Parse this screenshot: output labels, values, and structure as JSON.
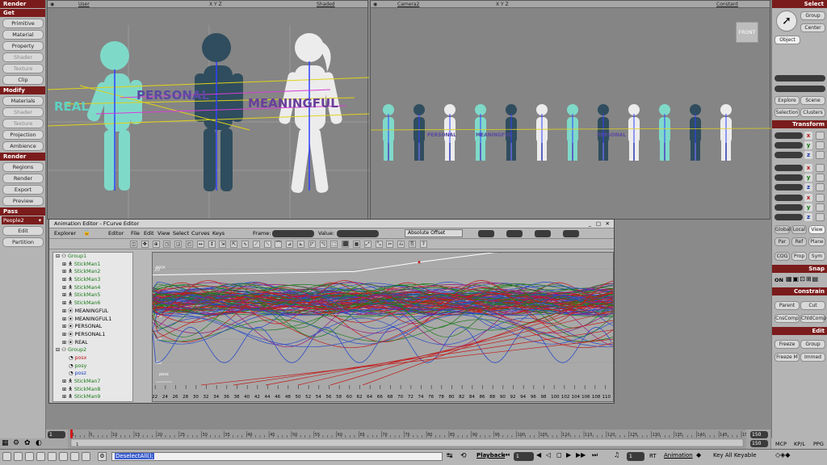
{
  "left_panel": {
    "render_header": "Render",
    "get_header": "Get",
    "get_items": [
      "Primitive",
      "Material",
      "Property",
      "Shader",
      "Texture",
      "Clip"
    ],
    "modify_header": "Modify",
    "modify_items": [
      "Materials",
      "Shader",
      "Texture",
      "Projection",
      "Ambience"
    ],
    "render_section_header": "Render",
    "render_items": [
      "Regions",
      "Render",
      "Export",
      "Preview"
    ],
    "pass_header": "Pass",
    "pass_value": "People2",
    "pass_items": [
      "Edit",
      "Partition"
    ]
  },
  "viewport_left": {
    "camera": "User",
    "mode": "Shaded",
    "axes": "X Y Z"
  },
  "viewport_right": {
    "camera": "Camera2",
    "mode": "Constant",
    "axes": "X Y Z",
    "cube_label": "FRONT"
  },
  "scene_text": {
    "word1": "REAL",
    "word2": "PERSONAL",
    "word3": "MEANINGFUL",
    "mini1": "PERSONAL",
    "mini2": "MEANINGFUL",
    "mini3": "PERSONAL"
  },
  "anim_editor": {
    "title": "Animation Editor - FCurve Editor",
    "menu": [
      "Explorer",
      "Editor",
      "File",
      "Edit",
      "View",
      "Select",
      "Curves",
      "Keys"
    ],
    "frame_label": "Frame:",
    "value_label": "Value:",
    "offset_mode": "Absolute Offset",
    "tree": [
      {
        "label": "Group1",
        "indent": 0,
        "kind": "group"
      },
      {
        "label": "StickMan1",
        "indent": 1,
        "kind": "man"
      },
      {
        "label": "StickMan2",
        "indent": 1,
        "kind": "man"
      },
      {
        "label": "StickMan3",
        "indent": 1,
        "kind": "man"
      },
      {
        "label": "StickMan4",
        "indent": 1,
        "kind": "man"
      },
      {
        "label": "StickMan5",
        "indent": 1,
        "kind": "man"
      },
      {
        "label": "StickMan6",
        "indent": 1,
        "kind": "man"
      },
      {
        "label": "MEANINGFUL",
        "indent": 1,
        "kind": "text"
      },
      {
        "label": "MEANINGFUL1",
        "indent": 1,
        "kind": "text"
      },
      {
        "label": "PERSONAL",
        "indent": 1,
        "kind": "text"
      },
      {
        "label": "PERSONAL1",
        "indent": 1,
        "kind": "text"
      },
      {
        "label": "REAL",
        "indent": 1,
        "kind": "text"
      },
      {
        "label": "Group2",
        "indent": 0,
        "kind": "group"
      },
      {
        "label": "posx",
        "indent": 2,
        "kind": "param"
      },
      {
        "label": "posy",
        "indent": 2,
        "kind": "param"
      },
      {
        "label": "posz",
        "indent": 2,
        "kind": "param"
      },
      {
        "label": "StickMan7",
        "indent": 1,
        "kind": "man"
      },
      {
        "label": "StickMan8",
        "indent": 1,
        "kind": "man"
      },
      {
        "label": "StickMan9",
        "indent": 1,
        "kind": "man"
      }
    ],
    "y_labels": [
      "20",
      "0",
      "-20",
      "-40",
      "-60"
    ],
    "x_labels": [
      "22",
      "24",
      "26",
      "28",
      "30",
      "32",
      "34",
      "36",
      "38",
      "40",
      "42",
      "44",
      "46",
      "48",
      "50",
      "52",
      "54",
      "56",
      "58",
      "60",
      "62",
      "64",
      "66",
      "68",
      "70",
      "72",
      "74",
      "76",
      "78",
      "80",
      "82",
      "84",
      "86",
      "88",
      "90",
      "92",
      "94",
      "96",
      "98",
      "100",
      "102",
      "104",
      "106",
      "108",
      "110"
    ],
    "curve_label_top": "posx",
    "curve_label_bottom": "posx"
  },
  "right_panel": {
    "select_header": "Select",
    "group": "Group",
    "center": "Center",
    "object": "Object",
    "explore": "Explore",
    "scene": "Scene",
    "selection": "Selection",
    "clusters": "Clusters",
    "transform_header": "Transform",
    "axes": [
      "x",
      "y",
      "z"
    ],
    "ref_modes": [
      "Global",
      "Local",
      "View"
    ],
    "ref_modes2": [
      "Par",
      "Ref",
      "Plane"
    ],
    "cog": "COG",
    "prop": "Prop",
    "sym": "Sym",
    "snap_header": "Snap",
    "snap_on": "ON",
    "constrain_header": "Constrain",
    "parent": "Parent",
    "cut": "Cut",
    "cnscomp": "CnsComp",
    "childcomp": "ChldComp",
    "edit_header": "Edit",
    "freeze": "Freeze",
    "group2": "Group",
    "freeze_m": "Freeze M",
    "immed": "Immed",
    "tabs": [
      "MCP",
      "KP/L",
      "PPG"
    ]
  },
  "timeline": {
    "start": "1",
    "current": "1",
    "end": "150",
    "end2": "150",
    "ticks": [
      "1",
      "5",
      "10",
      "15",
      "20",
      "25",
      "30",
      "35",
      "40",
      "45",
      "50",
      "55",
      "60",
      "65",
      "70",
      "75",
      "80",
      "85",
      "90",
      "95",
      "100",
      "105",
      "110",
      "115",
      "120",
      "125",
      "130",
      "135",
      "140",
      "145",
      "150"
    ]
  },
  "bottom": {
    "command": "DeselectAll();",
    "playback": "Playback",
    "frame": "1",
    "rt": "RT",
    "animation": "Animation",
    "keyable": "Key All Keyable"
  }
}
